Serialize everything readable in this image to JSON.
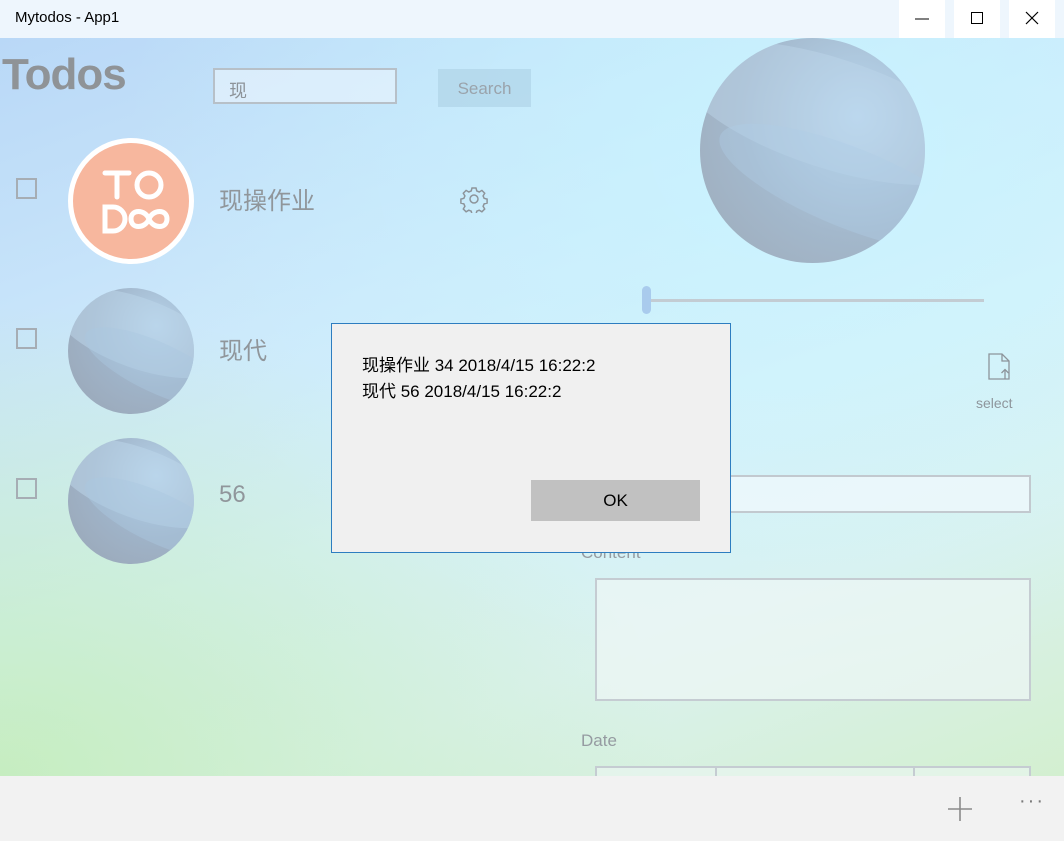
{
  "window": {
    "title": "Mytodos - App1",
    "minimize_label": "minimize",
    "maximize_label": "maximize",
    "close_label": "close"
  },
  "header": {
    "title": "Todos",
    "search_value": "现",
    "search_button": "Search"
  },
  "todos": [
    {
      "title": "现操作业",
      "checked": false,
      "avatar": "todo-logo"
    },
    {
      "title": "现代",
      "checked": false,
      "avatar": "abstract-blue"
    },
    {
      "title": "56",
      "checked": false,
      "avatar": "abstract-blue"
    }
  ],
  "detail": {
    "select_label": "select",
    "content_label": "Content",
    "date_label": "Date"
  },
  "dialog": {
    "lines": [
      "现操作业 34 2018/4/15 16:22:2",
      "现代 56 2018/4/15 16:22:2"
    ],
    "ok_button": "OK"
  },
  "commandbar": {
    "more_label": "···"
  },
  "colors": {
    "accent": "#2d7dc0",
    "todo_logo": "#f7b79e",
    "dialog_bg": "#f0f0f0"
  }
}
